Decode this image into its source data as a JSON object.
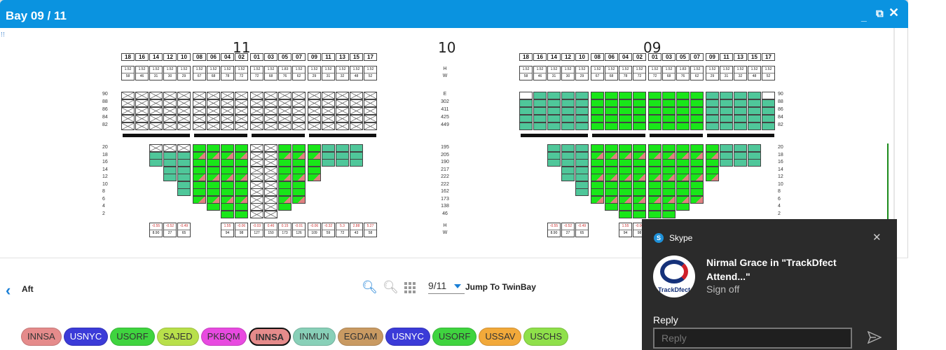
{
  "window": {
    "title": "Bay 09 / 11",
    "min": "_",
    "max": "⧉",
    "close": "✕"
  },
  "bays": {
    "left": "11",
    "mid": "10",
    "right": "09"
  },
  "stacks": [
    "18",
    "16",
    "14",
    "12",
    "10",
    "08",
    "06",
    "04",
    "02",
    "01",
    "03",
    "05",
    "07",
    "09",
    "11",
    "13",
    "15",
    "17"
  ],
  "deck_tiers": [
    "90",
    "88",
    "86",
    "84",
    "82"
  ],
  "hold_tiers": [
    "20",
    "18",
    "16",
    "14",
    "12",
    "10",
    "8",
    "6",
    "4",
    "2"
  ],
  "mid_deck": [
    "E",
    "302",
    "411",
    "425",
    "449"
  ],
  "mid_hold": [
    "195",
    "205",
    "190",
    "217",
    "222",
    "222",
    "162",
    "173",
    "138",
    "46"
  ],
  "mid_h_top": "H",
  "mid_w_top": "W",
  "mid_h_bot": "H",
  "mid_w_bot": "W",
  "weights_top": [
    "1.52",
    "1.52",
    "1.52",
    "1.52",
    "1.52",
    "1.52",
    "1.52",
    "1.52",
    "1.52",
    "1.52",
    "1.52",
    "1.83",
    "1.52",
    "1.52",
    "1.52",
    "1.52",
    "1.52",
    "1.52"
  ],
  "weights_bot": [
    "58",
    "46",
    "31",
    "30",
    "29",
    "67",
    "68",
    "78",
    "72",
    "72",
    "68",
    "76",
    "62",
    "29",
    "31",
    "32",
    "48",
    "52"
  ],
  "footer_top": [
    "-0.55",
    "-0.52",
    "-0.49",
    "1.55",
    "-0.06",
    "-0.03",
    "0.46",
    "0.15",
    "-0.01",
    "-0.06",
    "-0.32",
    "5.3",
    "2.88",
    "5.27"
  ],
  "footer_bot": [
    "8.90",
    "27",
    "65",
    "94",
    "98",
    "127",
    "150",
    "173",
    "126",
    "109",
    "59",
    "72",
    "43",
    "58"
  ],
  "toolbar": {
    "aft": "Aft",
    "pager": "9/11",
    "jump": "Jump To TwinBay"
  },
  "chips": [
    {
      "label": "INNSA",
      "color": "#e58b8b",
      "selected": false
    },
    {
      "label": "USNYC",
      "color": "#3b3bd8",
      "selected": false,
      "light": true
    },
    {
      "label": "USORF",
      "color": "#3fd43f",
      "selected": false
    },
    {
      "label": "SAJED",
      "color": "#b8e04a",
      "selected": false
    },
    {
      "label": "PKBQM",
      "color": "#e84ae0",
      "selected": false
    },
    {
      "label": "INNSA",
      "color": "#e58b8b",
      "selected": true
    },
    {
      "label": "INMUN",
      "color": "#88d0b8",
      "selected": false
    },
    {
      "label": "EGDAM",
      "color": "#c99a62",
      "selected": false
    },
    {
      "label": "USNYC",
      "color": "#3b3bd8",
      "selected": false,
      "light": true
    },
    {
      "label": "USORF",
      "color": "#3fd43f",
      "selected": false
    },
    {
      "label": "USSAV",
      "color": "#f2a93a",
      "selected": false
    },
    {
      "label": "USCHS",
      "color": "#8fe04a",
      "selected": false
    }
  ],
  "toast": {
    "app": "Skype",
    "sender": "Nirmal Grace in \"TrackDfect Attend...\"",
    "subtitle": "Sign off",
    "avatar_text": "TrackDfect",
    "reply_label": "Reply",
    "reply_placeholder": "Reply"
  },
  "colors": {
    "titlebar": "#0a93e0",
    "accent": "#1a7fd6",
    "green": "#19e619",
    "teal": "#4fc79a"
  }
}
